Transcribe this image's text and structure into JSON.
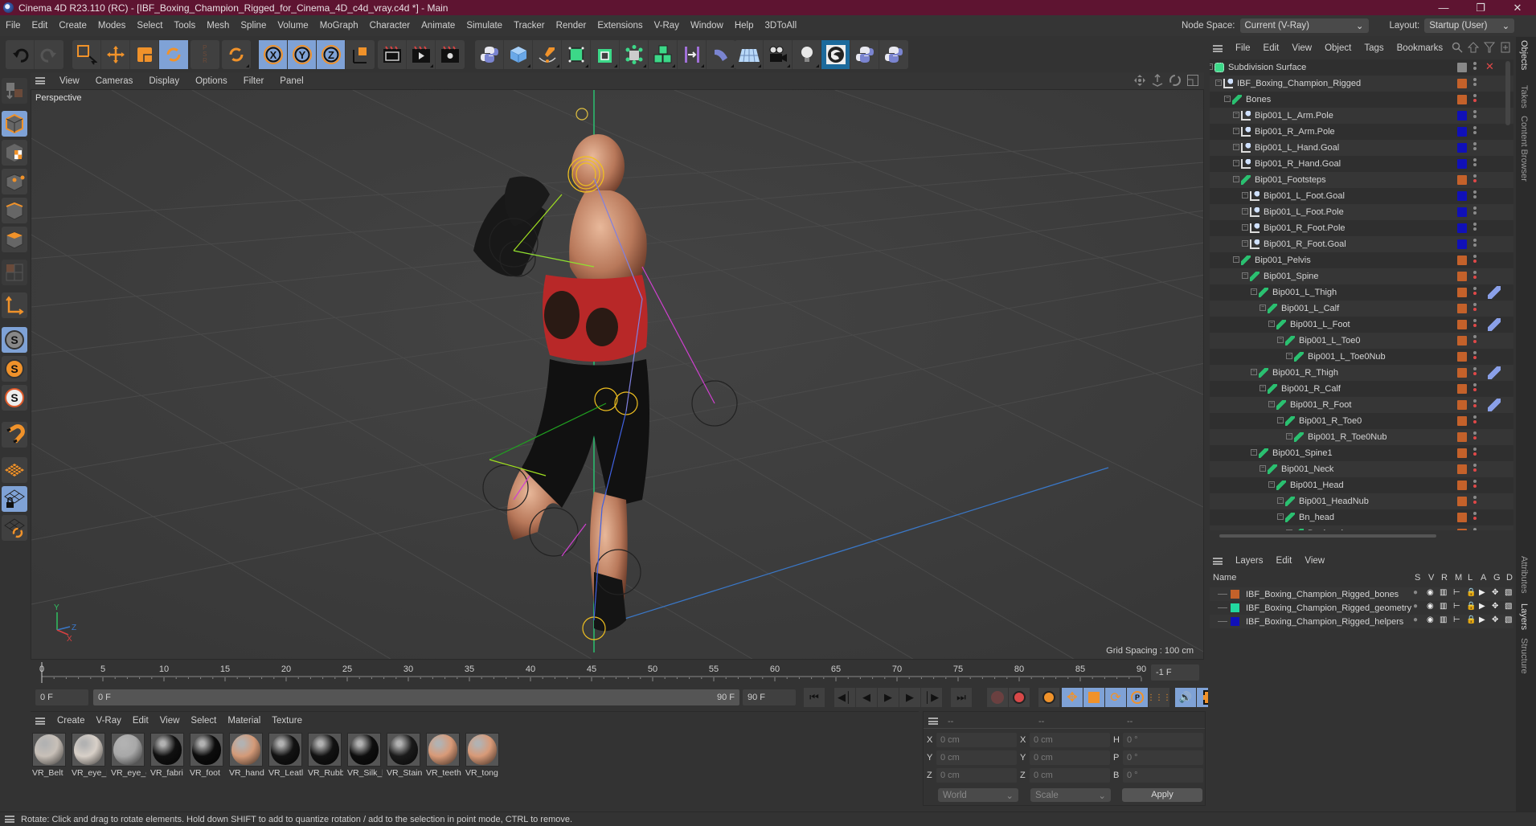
{
  "window": {
    "title": "Cinema 4D R23.110 (RC) - [IBF_Boxing_Champion_Rigged_for_Cinema_4D_c4d_vray.c4d *] - Main",
    "controls": [
      "minimize",
      "restore",
      "close"
    ]
  },
  "menubar": {
    "items": [
      "File",
      "Edit",
      "Create",
      "Modes",
      "Select",
      "Tools",
      "Mesh",
      "Spline",
      "Volume",
      "MoGraph",
      "Character",
      "Animate",
      "Simulate",
      "Tracker",
      "Render",
      "Extensions",
      "V-Ray",
      "Window",
      "Help",
      "3DToAll"
    ],
    "node_space_label": "Node Space:",
    "node_space_value": "Current (V-Ray)",
    "layout_label": "Layout:",
    "layout_value": "Startup (User)"
  },
  "toolbar": {
    "groups": [
      {
        "tools": [
          "undo-icon",
          "redo-icon"
        ]
      },
      {
        "tools": [
          "live-selection-icon",
          "move-icon",
          "scale-icon",
          "rotate-icon"
        ],
        "active": "rotate-icon"
      },
      {
        "tools": [
          "psr-icon"
        ]
      },
      {
        "tools": [
          "recent-tool-icon"
        ]
      },
      {
        "tools": [
          "x-axis-icon",
          "y-axis-icon",
          "z-axis-icon",
          "coordinate-system-icon"
        ],
        "active": [
          "x-axis-icon",
          "y-axis-icon",
          "z-axis-icon"
        ]
      },
      {
        "tools": [
          "render-view-icon",
          "render-picture-viewer-icon",
          "render-settings-icon"
        ]
      },
      {
        "tools": [
          "python-icon",
          "cube-icon",
          "pen-icon",
          "subdivision-icon",
          "extrude-icon",
          "array-icon",
          "cloner-icon",
          "bend-deformer-icon",
          "bend-icon"
        ]
      },
      {
        "tools": [
          "floor-icon",
          "camera-icon",
          "light-icon",
          "vray-icon",
          "python-icon",
          "python-icon"
        ]
      }
    ]
  },
  "left_tools": [
    "make-editable-icon",
    "model-mode-icon",
    "texture-mode-icon",
    "point-mode-icon",
    "edge-mode-icon",
    "polygon-mode-icon",
    "uvw-mode-icon",
    "axis-mode-icon",
    "solo-icon",
    "solo-hierarchy-icon",
    "solo-selection-icon",
    "magnet-icon",
    "workplane-icon",
    "locked-workplane-icon",
    "workplane-align-icon"
  ],
  "viewport": {
    "menu": [
      "View",
      "Cameras",
      "Display",
      "Options",
      "Filter",
      "Panel"
    ],
    "camera_label": "Perspective",
    "grid_spacing": "Grid Spacing : 100 cm",
    "axis_labels": {
      "x": "X",
      "y": "Y",
      "z": "Z"
    },
    "nav_icons": [
      "pan-icon",
      "dolly-icon",
      "orbit-icon",
      "maximize-icon"
    ]
  },
  "timeline": {
    "ticks": [
      "0",
      "5",
      "10",
      "15",
      "20",
      "25",
      "30",
      "35",
      "40",
      "45",
      "50",
      "55",
      "60",
      "65",
      "70",
      "75",
      "80",
      "85",
      "90"
    ],
    "current_frame": "-1 F",
    "start_field": "0 F",
    "range_start": "0 F",
    "range_end": "90 F",
    "end_field": "90 F"
  },
  "materials": {
    "menu": [
      "Create",
      "V-Ray",
      "Edit",
      "View",
      "Select",
      "Material",
      "Texture"
    ],
    "items": [
      {
        "name": "VR_Belt",
        "color": "#c8c0b8"
      },
      {
        "name": "VR_eye_i",
        "color": "#d8d0c8"
      },
      {
        "name": "VR_eye_c",
        "color": "#a8a8a8"
      },
      {
        "name": "VR_fabri",
        "color": "#101010"
      },
      {
        "name": "VR_foot",
        "color": "#0c0c0c"
      },
      {
        "name": "VR_hand",
        "color": "#d49a78"
      },
      {
        "name": "VR_Leatl",
        "color": "#121212"
      },
      {
        "name": "VR_Rubb",
        "color": "#121212"
      },
      {
        "name": "VR_Silk_l",
        "color": "#0e0e0e"
      },
      {
        "name": "VR_Stain",
        "color": "#1a1a1a"
      },
      {
        "name": "VR_teeth",
        "color": "#d89a78"
      },
      {
        "name": "VR_tong",
        "color": "#d89a78"
      }
    ]
  },
  "coordinates": {
    "headers": [
      "--",
      "--",
      "--"
    ],
    "rows": [
      {
        "l1": "X",
        "v1": "0 cm",
        "l2": "X",
        "v2": "0 cm",
        "l3": "H",
        "v3": "0 °"
      },
      {
        "l1": "Y",
        "v1": "0 cm",
        "l2": "Y",
        "v2": "0 cm",
        "l3": "P",
        "v3": "0 °"
      },
      {
        "l1": "Z",
        "v1": "0 cm",
        "l2": "Z",
        "v2": "0 cm",
        "l3": "B",
        "v3": "0 °"
      }
    ],
    "space_select": "World",
    "mode_select": "Scale",
    "apply_label": "Apply"
  },
  "object_manager": {
    "menu": [
      "File",
      "Edit",
      "View",
      "Object",
      "Tags",
      "Bookmarks"
    ],
    "rows": [
      {
        "name": "Subdivision Surface",
        "depth": 0,
        "type": "subdiv",
        "color": "",
        "red": false,
        "tag": ""
      },
      {
        "name": "IBF_Boxing_Champion_Rigged",
        "depth": 1,
        "type": "null",
        "color": "#c4612a",
        "red": false,
        "tag": ""
      },
      {
        "name": "Bones",
        "depth": 2,
        "type": "bone",
        "color": "#c4612a",
        "red": true,
        "tag": ""
      },
      {
        "name": "Bip001_L_Arm.Pole",
        "depth": 3,
        "type": "null",
        "color": "#1010b8",
        "red": false,
        "tag": ""
      },
      {
        "name": "Bip001_R_Arm.Pole",
        "depth": 3,
        "type": "null",
        "color": "#1010b8",
        "red": false,
        "tag": ""
      },
      {
        "name": "Bip001_L_Hand.Goal",
        "depth": 3,
        "type": "null",
        "color": "#1010b8",
        "red": false,
        "tag": ""
      },
      {
        "name": "Bip001_R_Hand.Goal",
        "depth": 3,
        "type": "null",
        "color": "#1010b8",
        "red": false,
        "tag": ""
      },
      {
        "name": "Bip001_Footsteps",
        "depth": 3,
        "type": "bone",
        "color": "#c4612a",
        "red": true,
        "tag": ""
      },
      {
        "name": "Bip001_L_Foot.Goal",
        "depth": 4,
        "type": "null",
        "color": "#1010b8",
        "red": false,
        "tag": ""
      },
      {
        "name": "Bip001_L_Foot.Pole",
        "depth": 4,
        "type": "null",
        "color": "#1010b8",
        "red": false,
        "tag": ""
      },
      {
        "name": "Bip001_R_Foot.Pole",
        "depth": 4,
        "type": "null",
        "color": "#1010b8",
        "red": false,
        "tag": ""
      },
      {
        "name": "Bip001_R_Foot.Goal",
        "depth": 4,
        "type": "null",
        "color": "#1010b8",
        "red": false,
        "tag": ""
      },
      {
        "name": "Bip001_Pelvis",
        "depth": 3,
        "type": "bone",
        "color": "#c4612a",
        "red": true,
        "tag": ""
      },
      {
        "name": "Bip001_Spine",
        "depth": 4,
        "type": "bone",
        "color": "#c4612a",
        "red": true,
        "tag": ""
      },
      {
        "name": "Bip001_L_Thigh",
        "depth": 5,
        "type": "bone",
        "color": "#c4612a",
        "red": true,
        "tag": "ik-tag-icon"
      },
      {
        "name": "Bip001_L_Calf",
        "depth": 6,
        "type": "bone",
        "color": "#c4612a",
        "red": true,
        "tag": ""
      },
      {
        "name": "Bip001_L_Foot",
        "depth": 7,
        "type": "bone",
        "color": "#c4612a",
        "red": true,
        "tag": "psr-tag-icon"
      },
      {
        "name": "Bip001_L_Toe0",
        "depth": 8,
        "type": "bone",
        "color": "#c4612a",
        "red": true,
        "tag": ""
      },
      {
        "name": "Bip001_L_Toe0Nub",
        "depth": 9,
        "type": "bone",
        "color": "#c4612a",
        "red": true,
        "tag": ""
      },
      {
        "name": "Bip001_R_Thigh",
        "depth": 5,
        "type": "bone",
        "color": "#c4612a",
        "red": true,
        "tag": "ik-tag-icon"
      },
      {
        "name": "Bip001_R_Calf",
        "depth": 6,
        "type": "bone",
        "color": "#c4612a",
        "red": true,
        "tag": ""
      },
      {
        "name": "Bip001_R_Foot",
        "depth": 7,
        "type": "bone",
        "color": "#c4612a",
        "red": true,
        "tag": "psr-tag-icon"
      },
      {
        "name": "Bip001_R_Toe0",
        "depth": 8,
        "type": "bone",
        "color": "#c4612a",
        "red": true,
        "tag": ""
      },
      {
        "name": "Bip001_R_Toe0Nub",
        "depth": 9,
        "type": "bone",
        "color": "#c4612a",
        "red": true,
        "tag": ""
      },
      {
        "name": "Bip001_Spine1",
        "depth": 5,
        "type": "bone",
        "color": "#c4612a",
        "red": true,
        "tag": ""
      },
      {
        "name": "Bip001_Neck",
        "depth": 6,
        "type": "bone",
        "color": "#c4612a",
        "red": true,
        "tag": ""
      },
      {
        "name": "Bip001_Head",
        "depth": 7,
        "type": "bone",
        "color": "#c4612a",
        "red": true,
        "tag": ""
      },
      {
        "name": "Bip001_HeadNub",
        "depth": 8,
        "type": "bone",
        "color": "#c4612a",
        "red": true,
        "tag": ""
      },
      {
        "name": "Bn_head",
        "depth": 8,
        "type": "bone",
        "color": "#c4612a",
        "red": true,
        "tag": ""
      },
      {
        "name": "Bn_head",
        "depth": 9,
        "type": "bone",
        "color": "#c4612a",
        "red": false,
        "tag": ""
      }
    ]
  },
  "layer_manager": {
    "menu": [
      "Layers",
      "Edit",
      "View"
    ],
    "columns": [
      "Name",
      "S",
      "V",
      "R",
      "M",
      "L",
      "A",
      "G",
      "D"
    ],
    "rows": [
      {
        "name": "IBF_Boxing_Champion_Rigged_bones",
        "color": "#c4612a",
        "locked": false
      },
      {
        "name": "IBF_Boxing_Champion_Rigged_geometry",
        "color": "#22d8a0",
        "locked": true
      },
      {
        "name": "IBF_Boxing_Champion_Rigged_helpers",
        "color": "#1010b8",
        "locked": false
      }
    ]
  },
  "side_tabs": {
    "top": [
      "Objects",
      "Takes",
      "Content Browser"
    ],
    "bottom": [
      "Attributes",
      "Layers",
      "Structure"
    ]
  },
  "status": "Rotate: Click and drag to rotate elements. Hold down SHIFT to add to quantize rotation / add to the selection in point mode, CTRL to remove.",
  "colors": {
    "titlebar": "#5e1431",
    "active_tool": "#7fa2d6",
    "accent_orange": "#f0922a",
    "bone_layer": "#c4612a",
    "geometry_layer": "#22d8a0",
    "helper_layer": "#1010b8"
  }
}
